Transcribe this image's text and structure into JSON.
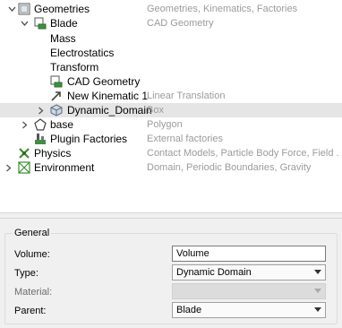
{
  "tree": {
    "rows": [
      {
        "label": "Geometries",
        "desc": "Geometries, Kinematics, Factories",
        "icon": "geometries-icon",
        "expander": "expanded"
      },
      {
        "label": "Blade",
        "desc": "CAD Geometry",
        "icon": "cad-geometry-icon",
        "expander": "expanded"
      },
      {
        "label": "Mass",
        "desc": "",
        "icon": "",
        "expander": "none"
      },
      {
        "label": "Electrostatics",
        "desc": "",
        "icon": "",
        "expander": "none"
      },
      {
        "label": "Transform",
        "desc": "",
        "icon": "",
        "expander": "none"
      },
      {
        "label": "CAD Geometry",
        "desc": "",
        "icon": "cad-geometry-icon",
        "expander": "none"
      },
      {
        "label": "New Kinematic 1",
        "desc": "Linear Translation",
        "icon": "kinematic-arrow-icon",
        "expander": "none"
      },
      {
        "label": "Dynamic_Domain",
        "desc": "Box",
        "icon": "box-icon",
        "expander": "collapsed",
        "selected": true
      },
      {
        "label": "base",
        "desc": "Polygon",
        "icon": "polygon-icon",
        "expander": "collapsed"
      },
      {
        "label": "Plugin Factories",
        "desc": "External factories",
        "icon": "plugin-factory-icon",
        "expander": "none"
      },
      {
        "label": "Physics",
        "desc": "Contact Models, Particle Body Force, Field ...",
        "icon": "physics-icon",
        "expander": "none"
      },
      {
        "label": "Environment",
        "desc": "Domain, Periodic Boundaries, Gravity",
        "icon": "environment-icon",
        "expander": "collapsed"
      }
    ]
  },
  "properties": {
    "group_title": "General",
    "volume": {
      "label": "Volume:",
      "value": "Volume"
    },
    "type": {
      "label": "Type:",
      "value": "Dynamic Domain"
    },
    "material": {
      "label": "Material:",
      "value": ""
    },
    "parent": {
      "label": "Parent:",
      "value": "Blade"
    }
  }
}
